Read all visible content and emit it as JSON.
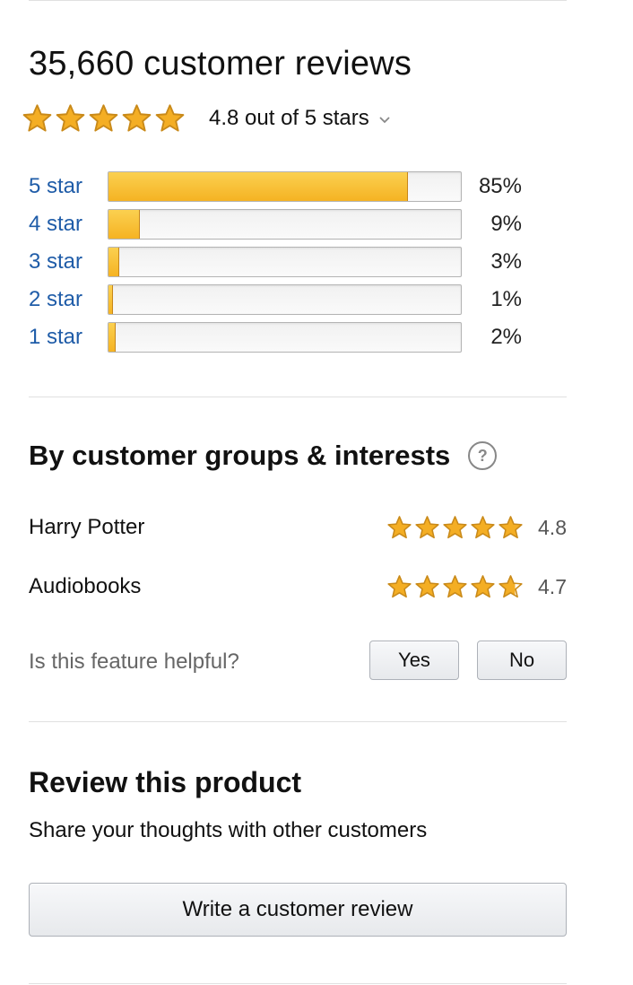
{
  "summary": {
    "title": "35,660 customer reviews",
    "average_text": "4.8 out of 5 stars",
    "average_rating": 4.8
  },
  "histogram": [
    {
      "label": "5 star",
      "percent_text": "85%",
      "percent": 85
    },
    {
      "label": "4 star",
      "percent_text": "9%",
      "percent": 9
    },
    {
      "label": "3 star",
      "percent_text": "3%",
      "percent": 3
    },
    {
      "label": "2 star",
      "percent_text": "1%",
      "percent": 1
    },
    {
      "label": "1 star",
      "percent_text": "2%",
      "percent": 2
    }
  ],
  "groups": {
    "title": "By customer groups & interests",
    "help_icon": "question-mark-icon",
    "items": [
      {
        "name": "Harry Potter",
        "score": "4.8",
        "rating": 4.8
      },
      {
        "name": "Audiobooks",
        "score": "4.7",
        "rating": 4.7
      }
    ],
    "helpful_question": "Is this feature helpful?",
    "yes_label": "Yes",
    "no_label": "No"
  },
  "review": {
    "title": "Review this product",
    "subtitle": "Share your thoughts with other customers",
    "button_label": "Write a customer review"
  },
  "colors": {
    "star_fill": "#f4ae24",
    "star_stroke": "#c98a1a",
    "link": "#1f5ca8",
    "bar_fill": "#f5b323"
  }
}
